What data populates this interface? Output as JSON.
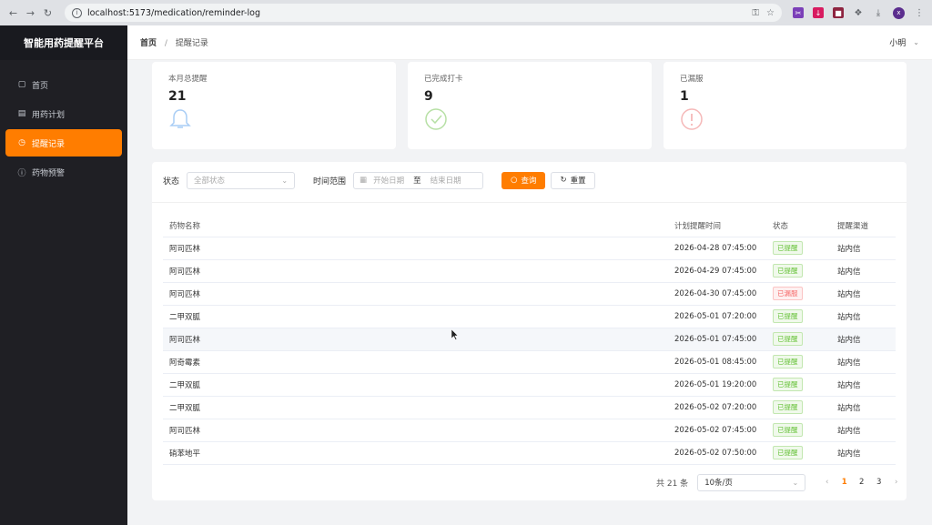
{
  "browser": {
    "url": "localhost:5173/medication/reminder-log"
  },
  "sidebar": {
    "brand": "智能用药提醒平台",
    "items": [
      {
        "label": "首页",
        "icon": "cart-icon"
      },
      {
        "label": "用药计划",
        "icon": "notebook-icon"
      },
      {
        "label": "提醒记录",
        "icon": "clock-icon",
        "active": true
      },
      {
        "label": "药物预警",
        "icon": "warning-circle-icon"
      }
    ]
  },
  "header": {
    "breadcrumb_home": "首页",
    "breadcrumb_sep": "/",
    "breadcrumb_current": "提醒记录",
    "user_name": "小明"
  },
  "stats": [
    {
      "label": "本月总提醒",
      "value": "21",
      "icon": "bell-icon",
      "color": "#a9cdf5"
    },
    {
      "label": "已完成打卡",
      "value": "9",
      "icon": "check-circle-icon",
      "color": "#b7e0a5"
    },
    {
      "label": "已漏服",
      "value": "1",
      "icon": "exclamation-circle-icon",
      "color": "#f5b8b8"
    }
  ],
  "filters": {
    "status_label": "状态",
    "status_placeholder": "全部状态",
    "time_label": "时间范围",
    "start_placeholder": "开始日期",
    "range_sep": "至",
    "end_placeholder": "结束日期",
    "search_label": "查询",
    "reset_label": "重置"
  },
  "table": {
    "columns": [
      "药物名称",
      "计划提醒时间",
      "状态",
      "提醒渠道"
    ],
    "rows": [
      {
        "name": "阿司匹林",
        "time": "2026-04-28 07:45:00",
        "status": "已提醒",
        "type": "ok",
        "channel": "站内信"
      },
      {
        "name": "阿司匹林",
        "time": "2026-04-29 07:45:00",
        "status": "已提醒",
        "type": "ok",
        "channel": "站内信"
      },
      {
        "name": "阿司匹林",
        "time": "2026-04-30 07:45:00",
        "status": "已漏服",
        "type": "miss",
        "channel": "站内信"
      },
      {
        "name": "二甲双胍",
        "time": "2026-05-01 07:20:00",
        "status": "已提醒",
        "type": "ok",
        "channel": "站内信"
      },
      {
        "name": "阿司匹林",
        "time": "2026-05-01 07:45:00",
        "status": "已提醒",
        "type": "ok",
        "channel": "站内信"
      },
      {
        "name": "阿奇霉素",
        "time": "2026-05-01 08:45:00",
        "status": "已提醒",
        "type": "ok",
        "channel": "站内信"
      },
      {
        "name": "二甲双胍",
        "time": "2026-05-01 19:20:00",
        "status": "已提醒",
        "type": "ok",
        "channel": "站内信"
      },
      {
        "name": "二甲双胍",
        "time": "2026-05-02 07:20:00",
        "status": "已提醒",
        "type": "ok",
        "channel": "站内信"
      },
      {
        "name": "阿司匹林",
        "time": "2026-05-02 07:45:00",
        "status": "已提醒",
        "type": "ok",
        "channel": "站内信"
      },
      {
        "name": "硝苯地平",
        "time": "2026-05-02 07:50:00",
        "status": "已提醒",
        "type": "ok",
        "channel": "站内信"
      }
    ]
  },
  "pagination": {
    "total": "共 21 条",
    "page_size": "10条/页",
    "pages": [
      "1",
      "2",
      "3"
    ],
    "current": "1"
  }
}
